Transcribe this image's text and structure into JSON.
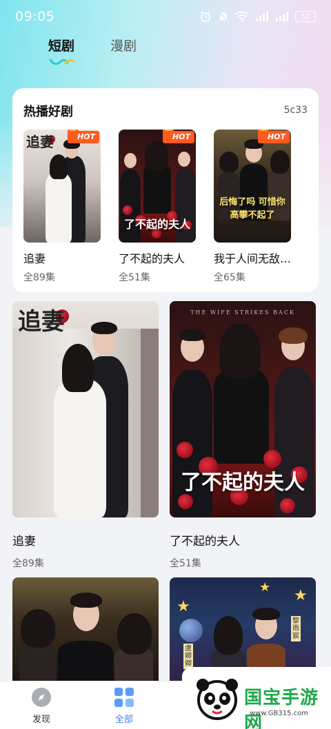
{
  "status_bar": {
    "time": "09:05",
    "battery": "52"
  },
  "tabs": [
    {
      "label": "短剧",
      "active": true
    },
    {
      "label": "漫剧",
      "active": false
    }
  ],
  "hot_section": {
    "title": "热播好剧",
    "count": "5c33",
    "badge": "HOT",
    "items": [
      {
        "name": "追妻",
        "episodes": "全89集",
        "poster_text": "追妻"
      },
      {
        "name": "了不起的夫人",
        "episodes": "全51集",
        "poster_text": "了不起的夫人"
      },
      {
        "name": "我于人间无敌…",
        "episodes": "全65集",
        "poster_text": "后悔了吗 可惜你 高攀不起了"
      }
    ]
  },
  "grid": [
    {
      "name": "追妻",
      "episodes": "全89集",
      "poster_text": "追妻"
    },
    {
      "name": "了不起的夫人",
      "episodes": "全51集",
      "poster_text": "了不起的夫人",
      "poster_subtitle": "THE WIFE STRIKES BACK"
    },
    {
      "name": "",
      "episodes": "",
      "poster_text": ""
    },
    {
      "name": "",
      "episodes": "",
      "poster_text": "",
      "poster_labels": [
        "虞卿卿",
        "黎雨宸"
      ]
    }
  ],
  "bottom_nav": [
    {
      "label": "发现",
      "icon": "compass-icon",
      "active": false
    },
    {
      "label": "全部",
      "icon": "grid-icon",
      "active": true
    }
  ],
  "watermark": {
    "text": "国宝手游网",
    "url": "www.GB315.com"
  },
  "colors": {
    "accent": "#3f7ef5",
    "hot_badge": "#ff5a1f",
    "watermark_green": "#1fa84a"
  }
}
